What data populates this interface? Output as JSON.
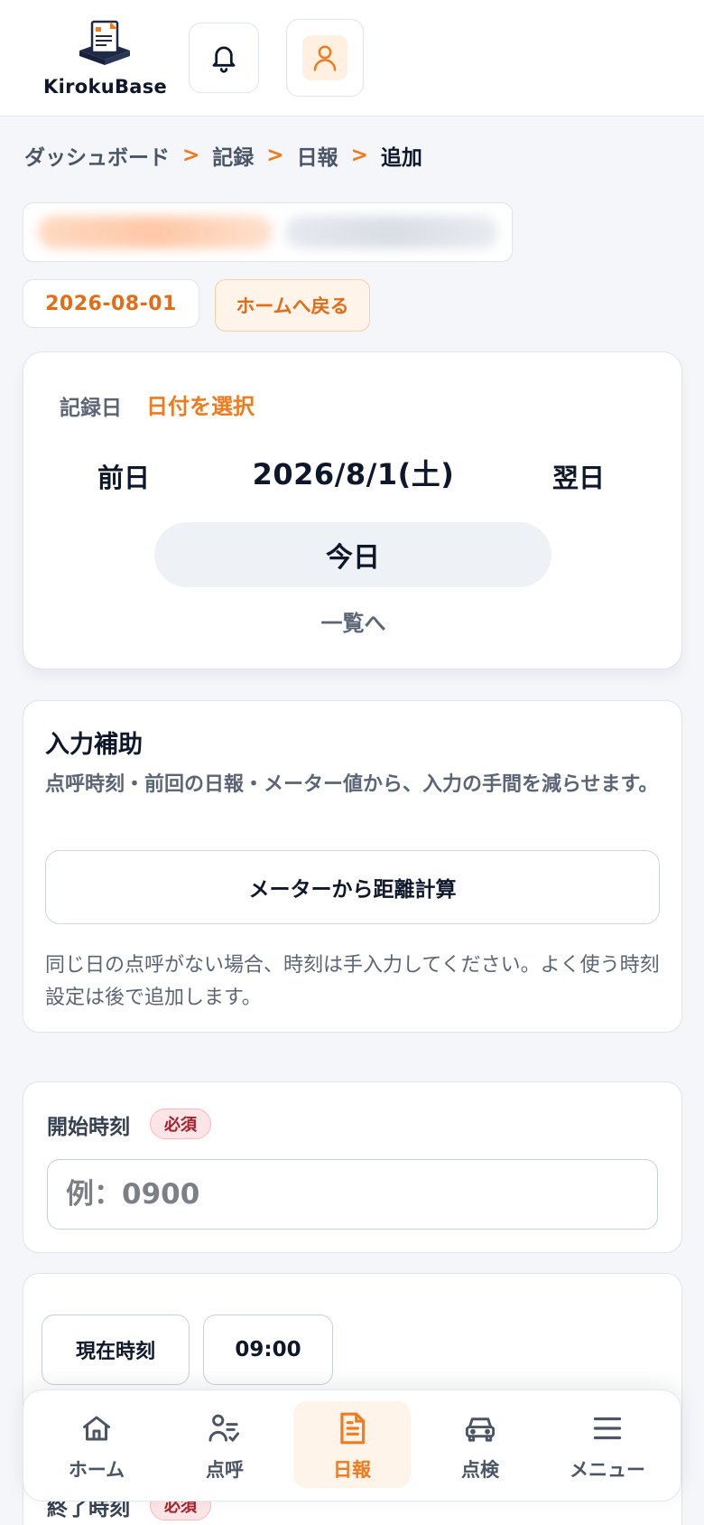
{
  "header": {
    "logo_text": "KirokuBase"
  },
  "breadcrumb": {
    "items": [
      "ダッシュボード",
      "記録",
      "日報"
    ],
    "separator": ">",
    "current": "追加"
  },
  "date_chip": "2026-08-01",
  "home_back_label": "ホームへ戻る",
  "date_card": {
    "record_label": "記録日",
    "select_label": "日付を選択",
    "prev_label": "前日",
    "current_date": "2026/8/1(土)",
    "next_label": "翌日",
    "today_label": "今日",
    "list_label": "一覧へ"
  },
  "assist": {
    "title": "入力補助",
    "description": "点呼時刻・前回の日報・メーター値から、入力の手間を減らせます。",
    "meter_button": "メーターから距離計算",
    "note": "同じ日の点呼がない場合、時刻は手入力してください。よく使う時刻設定は後で追加します。"
  },
  "start_time": {
    "label": "開始時刻",
    "required_badge": "必須",
    "placeholder": "例：0900"
  },
  "quick": {
    "now_button": "現在時刻",
    "time_button": "09:00",
    "next_label": "終了時刻",
    "next_required_badge": "必須"
  },
  "nav": {
    "items": [
      {
        "label": "ホーム",
        "icon": "home-icon"
      },
      {
        "label": "点呼",
        "icon": "user-check-icon"
      },
      {
        "label": "日報",
        "icon": "document-icon"
      },
      {
        "label": "点検",
        "icon": "car-icon"
      },
      {
        "label": "メニュー",
        "icon": "menu-icon"
      }
    ],
    "active_index": 2
  },
  "colors": {
    "accent": "#f07a1e",
    "accent_dark": "#e56b14",
    "text": "#0f172a",
    "muted": "#5b6576",
    "required": "#a3222e"
  }
}
